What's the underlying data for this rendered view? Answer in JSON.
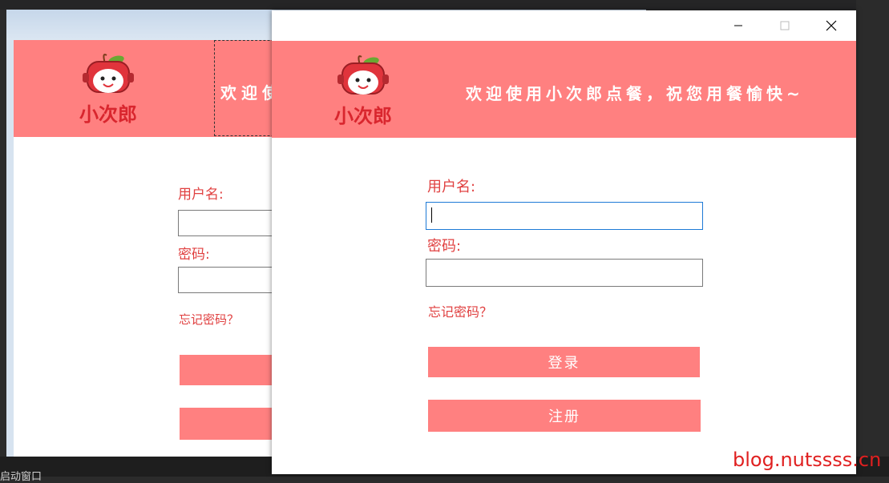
{
  "brand": {
    "name": "小次郎",
    "welcome": "欢迎使用小次郎点餐，祝您用餐愉快~",
    "welcome_partial": "欢迎使",
    "colors": {
      "header": "#ff8080",
      "label": "#e04040",
      "focus_border": "#1e7ad6"
    }
  },
  "window": {
    "controls": {
      "minimize_icon": "minimize-icon",
      "maximize_icon": "maximize-icon",
      "close_icon": "close-icon"
    }
  },
  "form": {
    "username_label": "用户名:",
    "username_value": "",
    "password_label": "密码:",
    "password_value": "",
    "forgot_label": "忘记密码？",
    "login_label": "登录",
    "register_label": "注册"
  },
  "background_ide": {
    "status_text": "启动窗口"
  },
  "watermark": "blog.nutssss.cn"
}
